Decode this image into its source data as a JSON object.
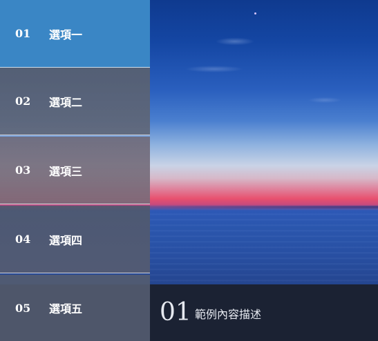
{
  "tabs": [
    {
      "num": "01",
      "label": "選項一"
    },
    {
      "num": "02",
      "label": "選項二"
    },
    {
      "num": "03",
      "label": "選項三"
    },
    {
      "num": "04",
      "label": "選項四"
    },
    {
      "num": "05",
      "label": "選項五"
    }
  ],
  "active_tab": "01",
  "caption": {
    "num": "01",
    "text": "範例內容描述"
  },
  "colors": {
    "active_tab": "#3a86c5",
    "caption_bg": "#1b2233"
  }
}
